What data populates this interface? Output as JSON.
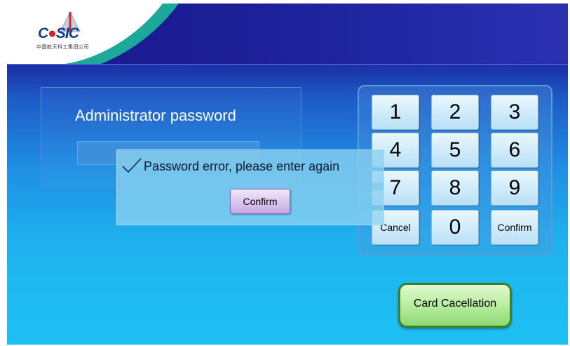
{
  "brand": {
    "logo_text_a": "C",
    "logo_text_b": "SIC",
    "logo_subtitle": "中国航天科工集团公司"
  },
  "password_panel": {
    "title": "Administrator password",
    "value": ""
  },
  "keypad": {
    "keys": [
      "1",
      "2",
      "3",
      "4",
      "5",
      "6",
      "7",
      "8",
      "9",
      "Cancel",
      "0",
      "Confirm"
    ]
  },
  "dialog": {
    "icon": "check-icon",
    "message": "Password error, please enter again",
    "confirm_label": "Confirm"
  },
  "card_button": {
    "label": "Card Cacellation"
  },
  "colors": {
    "header": "#1a168e",
    "background_bottom": "#1ec1f2",
    "keypad_key": "#cdebfa",
    "dialog_button": "#d8c2ec",
    "card_button": "#b9eea0",
    "logo_teal": "#1ca99c"
  }
}
